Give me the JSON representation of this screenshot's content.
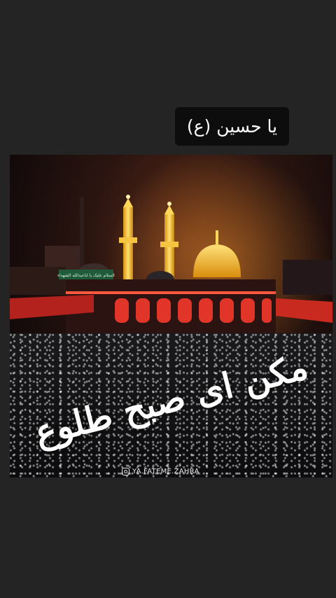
{
  "caption": {
    "text": "یا حسین (ع)"
  },
  "image": {
    "calligraphy": "مکن ای صبح طلوع",
    "banner": "السلام علیک یا اباعبدالله الشهداء",
    "watermark": "YA.FATEME.ZAHRA",
    "watermark_icon": "instagram-icon"
  },
  "colors": {
    "background": "#242424",
    "caption_bg": "#0d0d0d",
    "gold": "#f2b21a",
    "red_light": "#e2352a"
  }
}
